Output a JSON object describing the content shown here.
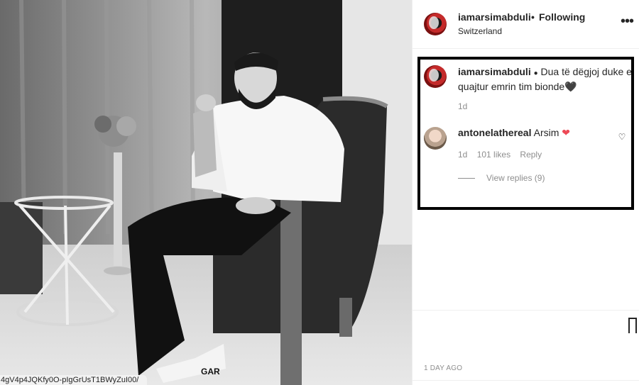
{
  "photo": {
    "url_fragment": "4gV4p4JQKfy0O-pIgGrUsT1BWyZuI00/",
    "shoe_text": "GAR"
  },
  "header": {
    "username": "iamarsimabduli",
    "separator": "•",
    "follow_status": "Following",
    "location": "Switzerland",
    "more": "•••"
  },
  "caption": {
    "username": "iamarsimabduli",
    "bullet": "●",
    "text": "Dua të dëgjoj duke e quajtur emrin tim bionde",
    "emoji": "🖤",
    "time": "1d"
  },
  "comment": {
    "username": "antonelathereal",
    "text": "Arsim",
    "emoji": "❤",
    "time": "1d",
    "likes": "101 likes",
    "reply": "Reply",
    "view_replies": "View replies (9)",
    "like_icon": "♡"
  },
  "footer": {
    "time_ago": "1 DAY AGO"
  },
  "colors": {
    "text": "#262626",
    "muted": "#8e8e8e",
    "heart": "#ed4956",
    "highlight": "#000000"
  }
}
